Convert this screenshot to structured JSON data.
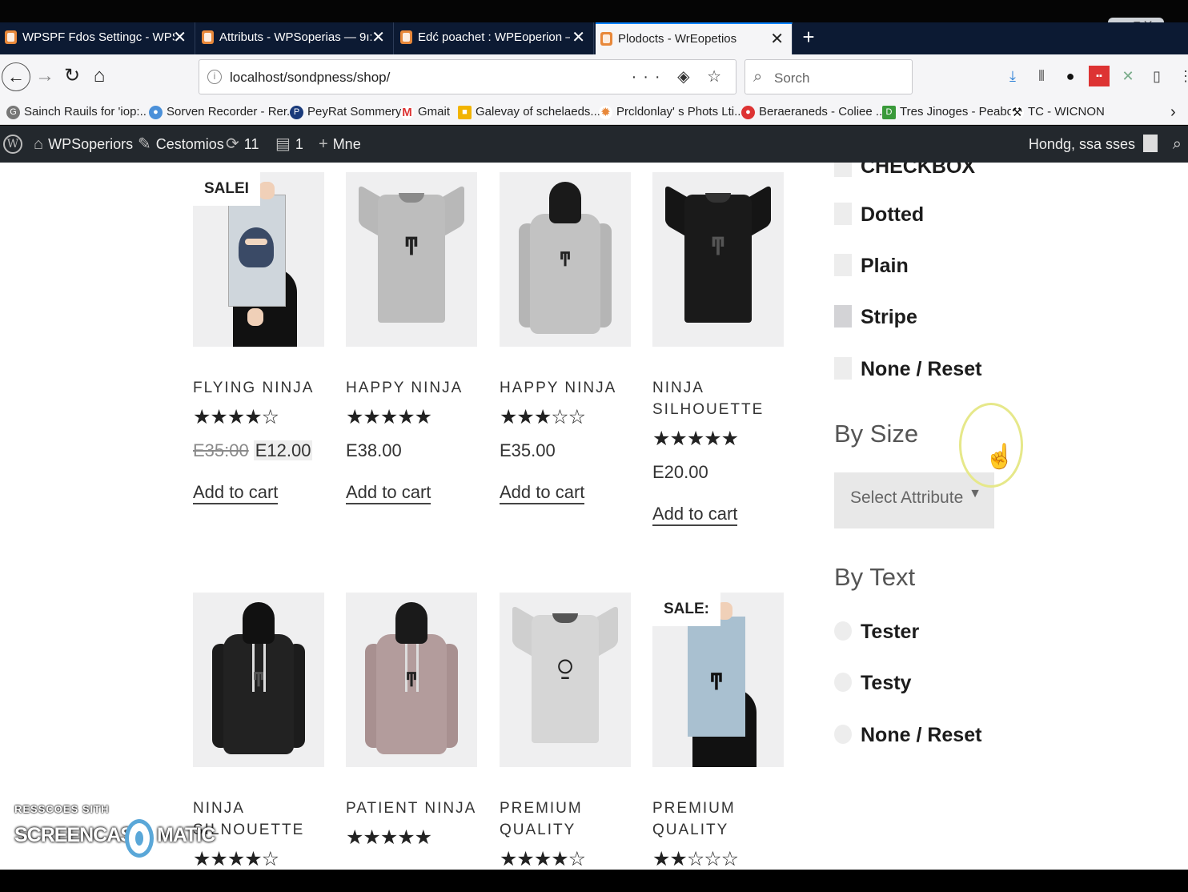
{
  "browser": {
    "window_controls": "—  ▢  ⨉",
    "tabs": [
      {
        "label": "WPSPF Fdos Settingc - WPSopı",
        "close": "✕",
        "active": false
      },
      {
        "label": "Attributs - WPSoperias — 9ı:",
        "close": "✕",
        "active": false
      },
      {
        "label": "Edć poachet : WPEoperion — I",
        "close": "✕",
        "active": false
      },
      {
        "label": "Plodocts - WrEopetios",
        "close": "✕",
        "active": true
      }
    ],
    "new_tab": "+",
    "nav": {
      "back": "←",
      "forward": "→",
      "reload": "↻",
      "home": "⌂"
    },
    "url": "localhost/sondpness/shop/",
    "url_actions": "··· ◈ ☆",
    "search_placeholder": "Sorch",
    "search_icon": "search-icon",
    "extensions": [
      "download-icon",
      "library-icon",
      "circle-icon",
      "badge-icon",
      "tools-icon",
      "sidebar-icon",
      "menu-icon"
    ],
    "bookmarks": [
      {
        "label": "Sainch Rauils for 'iop:..",
        "icon": "G"
      },
      {
        "label": "Sorven Recorder - Rer...",
        "icon": "●"
      },
      {
        "label": "PeyRat Sommery",
        "icon": "P"
      },
      {
        "label": "Gmait",
        "icon": "M"
      },
      {
        "label": "Galevay of schelaeds...",
        "icon": "■"
      },
      {
        "label": "Prcldonlay' s Phots Lti...",
        "icon": "✹"
      },
      {
        "label": "Beraeraneds - Coliee ...",
        "icon": "●"
      },
      {
        "label": "Tres Jinoges - Peaboy",
        "icon": "D"
      },
      {
        "label": "TC - WICNON",
        "icon": "⚒"
      }
    ],
    "bookmarks_more": "›"
  },
  "admin_bar": {
    "logo": "W",
    "site": "WPSoperiors",
    "customize": "Cestomios",
    "updates": "11",
    "comments": "1",
    "new": "Mne",
    "greeting": "Hondg, ssa sses"
  },
  "products_row1": [
    {
      "name": "FLYING NINJA",
      "rating": "★★★★☆",
      "rating_value": 4,
      "old_price": "E35:00",
      "price": "E12.00",
      "sale": "SALEI",
      "cta": "Add to cart",
      "type": "poster"
    },
    {
      "name": "HAPPY NINJA",
      "rating": "★★★★★",
      "rating_value": 5,
      "old_price": "",
      "price": "E38.00",
      "sale": "",
      "cta": "Add to cart",
      "type": "tee-grey"
    },
    {
      "name": "HAPPY NINJA",
      "rating": "★★★☆☆",
      "rating_value": 3,
      "old_price": "",
      "price": "E35.00",
      "sale": "",
      "cta": "Add to cart",
      "type": "hoodie-grey"
    },
    {
      "name": "NINJA SILHOUETTE",
      "rating": "★★★★★",
      "rating_value": 5,
      "old_price": "",
      "price": "E20.00",
      "sale": "",
      "cta": "Add to cart",
      "type": "tee-black"
    }
  ],
  "products_row2": [
    {
      "name": "NINJA SILNOUETTE",
      "rating": "★★★★☆",
      "rating_value": 4,
      "sale": "",
      "type": "hoodie-black"
    },
    {
      "name": "PATIENT NINJA",
      "rating": "★★★★★",
      "rating_value": 5,
      "sale": "",
      "type": "hoodie-pink"
    },
    {
      "name": "PREMIUM QUALITY",
      "rating": "★★★★☆",
      "rating_value": 4.5,
      "sale": "",
      "type": "tee-white"
    },
    {
      "name": "PREMIUM QUALITY",
      "rating": "★★☆☆☆",
      "rating_value": 2,
      "sale": "SALE:",
      "type": "poster-blue"
    }
  ],
  "filters": {
    "partial_label": "CHECKBOX",
    "checkbox_options": [
      {
        "label": "Dotted",
        "checked": false
      },
      {
        "label": "Plain",
        "checked": false
      },
      {
        "label": "Stripe",
        "checked": true
      },
      {
        "label": "None / Reset",
        "checked": false
      }
    ],
    "by_size": {
      "heading": "By Size",
      "select_value": "Select Attribute",
      "arrow": "▼"
    },
    "by_text": {
      "heading": "By Text",
      "options": [
        {
          "label": "Tester"
        },
        {
          "label": "Testy"
        },
        {
          "label": "None / Reset"
        }
      ]
    }
  },
  "watermark": {
    "top": "RESSCOES SITH",
    "left": "SCREENCAST",
    "right": "MATIC"
  }
}
